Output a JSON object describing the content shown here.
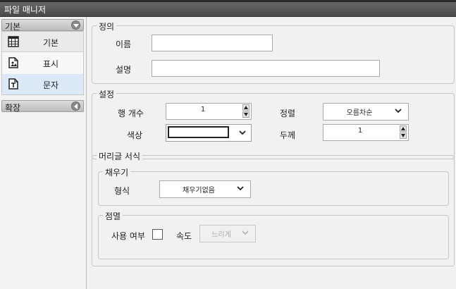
{
  "window": {
    "title": "파일 매니저"
  },
  "sidebar": {
    "groups": [
      {
        "label": "기본",
        "toggle": "collapse"
      },
      {
        "label": "확장",
        "toggle": "expand"
      }
    ],
    "items": [
      {
        "label": "기본",
        "icon": "grid-table-icon"
      },
      {
        "label": "표시",
        "icon": "document-image-icon"
      },
      {
        "label": "문자",
        "icon": "document-text-icon"
      }
    ],
    "active_item": "문자"
  },
  "definition": {
    "legend": "정의",
    "name_label": "이름",
    "name_value": "",
    "desc_label": "설명",
    "desc_value": ""
  },
  "settings": {
    "legend": "설정",
    "rows_label": "행 개수",
    "rows_value": "1",
    "align_label": "정렬",
    "align_value": "오름차순",
    "color_label": "색상",
    "color_value": "#ffffff",
    "thickness_label": "두께",
    "thickness_value": "1"
  },
  "header_format": {
    "legend": "머리글 서식",
    "fill": {
      "legend": "채우기",
      "type_label": "형식",
      "type_value": "채우기없음"
    },
    "blink": {
      "legend": "점멸",
      "use_label": "사용 여부",
      "use_checked": false,
      "speed_label": "속도",
      "speed_value": "느리게"
    }
  }
}
